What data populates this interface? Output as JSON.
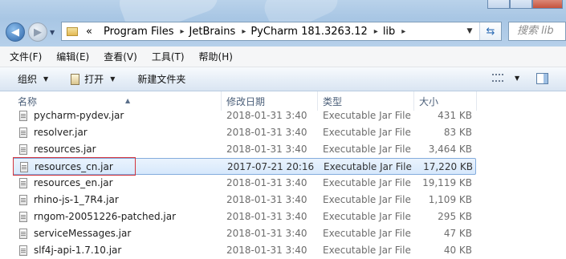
{
  "nav": {
    "back_icon": "back-arrow-icon",
    "forward_icon": "forward-arrow-icon",
    "history_icon": "chevron-down-icon"
  },
  "address": {
    "overflow": "«",
    "crumbs": [
      "Program Files",
      "JetBrains",
      "PyCharm 181.3263.12",
      "lib"
    ],
    "separator": "▸",
    "refresh_icon": "refresh-icon"
  },
  "search": {
    "placeholder": "搜索 lib"
  },
  "menu": [
    "文件(F)",
    "编辑(E)",
    "查看(V)",
    "工具(T)",
    "帮助(H)"
  ],
  "toolbar": {
    "organize": "组织",
    "open": "打开",
    "new_folder": "新建文件夹",
    "dropdown_arrow": "▼"
  },
  "columns": {
    "name": "名称",
    "date": "修改日期",
    "type": "类型",
    "size": "大小",
    "sort_indicator": "▲"
  },
  "files": [
    {
      "name": "pycharm-pydev.jar",
      "date": "2018-01-31 3:40",
      "type": "Executable Jar File",
      "size": "431 KB"
    },
    {
      "name": "resolver.jar",
      "date": "2018-01-31 3:40",
      "type": "Executable Jar File",
      "size": "83 KB"
    },
    {
      "name": "resources.jar",
      "date": "2018-01-31 3:40",
      "type": "Executable Jar File",
      "size": "3,464 KB"
    },
    {
      "name": "resources_cn.jar",
      "date": "2017-07-21 20:16",
      "type": "Executable Jar File",
      "size": "17,220 KB",
      "selected": true
    },
    {
      "name": "resources_en.jar",
      "date": "2018-01-31 3:40",
      "type": "Executable Jar File",
      "size": "19,119 KB"
    },
    {
      "name": "rhino-js-1_7R4.jar",
      "date": "2018-01-31 3:40",
      "type": "Executable Jar File",
      "size": "1,109 KB"
    },
    {
      "name": "rngom-20051226-patched.jar",
      "date": "2018-01-31 3:40",
      "type": "Executable Jar File",
      "size": "295 KB"
    },
    {
      "name": "serviceMessages.jar",
      "date": "2018-01-31 3:40",
      "type": "Executable Jar File",
      "size": "47 KB"
    },
    {
      "name": "slf4j-api-1.7.10.jar",
      "date": "2018-01-31 3:40",
      "type": "Executable Jar File",
      "size": "40 KB"
    }
  ],
  "colors": {
    "selection_border": "#84acdd",
    "highlight_box": "#d3343d",
    "title_bar": "#b9d2ea"
  }
}
